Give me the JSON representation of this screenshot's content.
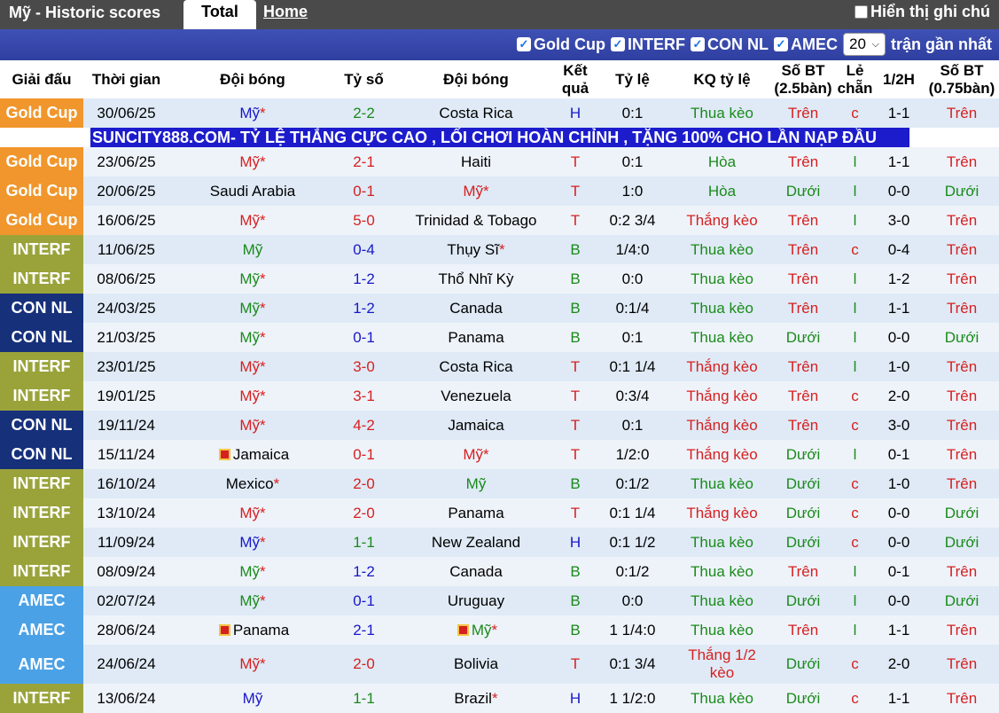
{
  "topbar": {
    "title": "Mỹ - Historic scores",
    "tab_total": "Total",
    "tab_home": "Home",
    "note_label": "Hiển thị ghi chú"
  },
  "filters": {
    "items": [
      "Gold Cup",
      "INTERF",
      "CON NL",
      "AMEC"
    ],
    "count_value": "20",
    "count_suffix": "trận gần nhất"
  },
  "columns": {
    "league": "Giải đấu",
    "time": "Thời gian",
    "home": "Đội bóng",
    "score": "Tỷ số",
    "away": "Đội bóng",
    "result": "Kết quả",
    "odds": "Tỷ lệ",
    "odds_result": "KQ tỷ lệ",
    "ou25": "Số BT (2.5bàn)",
    "oddeven": "Lẻ chẵn",
    "half": "1/2H",
    "ou075": "Số BT (0.75bàn)"
  },
  "league_colors": {
    "Gold Cup": "#f0962c",
    "INTERF": "#9aa33a",
    "CON NL": "#16307a",
    "AMEC": "#4aa1e6"
  },
  "ad_text": "SUNCITY888.COM- TỶ LỆ THẮNG CỰC CAO , LỐI CHƠI HOÀN CHỈNH , TẶNG 100% CHO LẦN NẠP ĐẦU",
  "rows": [
    {
      "league": "Gold Cup",
      "time": "30/06/25",
      "home": "Mỹ",
      "home_star": "*",
      "home_flag": false,
      "home_color": "blue",
      "score": "2-2",
      "score_color": "green",
      "away": "Costa Rica",
      "away_star": "",
      "away_flag": false,
      "away_color": "black",
      "result": "H",
      "result_color": "blue",
      "odds": "0:1",
      "odds_result": "Thua kèo",
      "odds_result_color": "green",
      "ou25": "Trên",
      "ou25_color": "red",
      "oddeven": "c",
      "oddeven_color": "red",
      "half": "1-1",
      "ou075": "Trên",
      "ou075_color": "red"
    },
    {
      "league": "Gold Cup",
      "time": "23/06/25",
      "home": "Mỹ",
      "home_star": "*",
      "home_flag": false,
      "home_color": "red",
      "score": "2-1",
      "score_color": "red",
      "away": "Haiti",
      "away_star": "",
      "away_flag": false,
      "away_color": "black",
      "result": "T",
      "result_color": "red",
      "odds": "0:1",
      "odds_result": "Hòa",
      "odds_result_color": "green",
      "ou25": "Trên",
      "ou25_color": "red",
      "oddeven": "l",
      "oddeven_color": "green",
      "half": "1-1",
      "ou075": "Trên",
      "ou075_color": "red"
    },
    {
      "league": "Gold Cup",
      "time": "20/06/25",
      "home": "Saudi Arabia",
      "home_star": "",
      "home_flag": false,
      "home_color": "black",
      "score": "0-1",
      "score_color": "red",
      "away": "Mỹ",
      "away_star": "*",
      "away_flag": false,
      "away_color": "red",
      "result": "T",
      "result_color": "red",
      "odds": "1:0",
      "odds_result": "Hòa",
      "odds_result_color": "green",
      "ou25": "Dưới",
      "ou25_color": "green",
      "oddeven": "l",
      "oddeven_color": "green",
      "half": "0-0",
      "ou075": "Dưới",
      "ou075_color": "green"
    },
    {
      "league": "Gold Cup",
      "time": "16/06/25",
      "home": "Mỹ",
      "home_star": "*",
      "home_flag": false,
      "home_color": "red",
      "score": "5-0",
      "score_color": "red",
      "away": "Trinidad & Tobago",
      "away_star": "",
      "away_flag": false,
      "away_color": "black",
      "result": "T",
      "result_color": "red",
      "odds": "0:2 3/4",
      "odds_result": "Thắng kèo",
      "odds_result_color": "red",
      "ou25": "Trên",
      "ou25_color": "red",
      "oddeven": "l",
      "oddeven_color": "green",
      "half": "3-0",
      "ou075": "Trên",
      "ou075_color": "red"
    },
    {
      "league": "INTERF",
      "time": "11/06/25",
      "home": "Mỹ",
      "home_star": "",
      "home_flag": false,
      "home_color": "green",
      "score": "0-4",
      "score_color": "blue",
      "away": "Thụy Sĩ",
      "away_star": "*",
      "away_flag": false,
      "away_color": "black",
      "result": "B",
      "result_color": "green",
      "odds": "1/4:0",
      "odds_result": "Thua kèo",
      "odds_result_color": "green",
      "ou25": "Trên",
      "ou25_color": "red",
      "oddeven": "c",
      "oddeven_color": "red",
      "half": "0-4",
      "ou075": "Trên",
      "ou075_color": "red"
    },
    {
      "league": "INTERF",
      "time": "08/06/25",
      "home": "Mỹ",
      "home_star": "*",
      "home_flag": false,
      "home_color": "green",
      "score": "1-2",
      "score_color": "blue",
      "away": "Thổ Nhĩ Kỳ",
      "away_star": "",
      "away_flag": false,
      "away_color": "black",
      "result": "B",
      "result_color": "green",
      "odds": "0:0",
      "odds_result": "Thua kèo",
      "odds_result_color": "green",
      "ou25": "Trên",
      "ou25_color": "red",
      "oddeven": "l",
      "oddeven_color": "green",
      "half": "1-2",
      "ou075": "Trên",
      "ou075_color": "red"
    },
    {
      "league": "CON NL",
      "time": "24/03/25",
      "home": "Mỹ",
      "home_star": "*",
      "home_flag": false,
      "home_color": "green",
      "score": "1-2",
      "score_color": "blue",
      "away": "Canada",
      "away_star": "",
      "away_flag": false,
      "away_color": "black",
      "result": "B",
      "result_color": "green",
      "odds": "0:1/4",
      "odds_result": "Thua kèo",
      "odds_result_color": "green",
      "ou25": "Trên",
      "ou25_color": "red",
      "oddeven": "l",
      "oddeven_color": "green",
      "half": "1-1",
      "ou075": "Trên",
      "ou075_color": "red"
    },
    {
      "league": "CON NL",
      "time": "21/03/25",
      "home": "Mỹ",
      "home_star": "*",
      "home_flag": false,
      "home_color": "green",
      "score": "0-1",
      "score_color": "blue",
      "away": "Panama",
      "away_star": "",
      "away_flag": false,
      "away_color": "black",
      "result": "B",
      "result_color": "green",
      "odds": "0:1",
      "odds_result": "Thua kèo",
      "odds_result_color": "green",
      "ou25": "Dưới",
      "ou25_color": "green",
      "oddeven": "l",
      "oddeven_color": "green",
      "half": "0-0",
      "ou075": "Dưới",
      "ou075_color": "green"
    },
    {
      "league": "INTERF",
      "time": "23/01/25",
      "home": "Mỹ",
      "home_star": "*",
      "home_flag": false,
      "home_color": "red",
      "score": "3-0",
      "score_color": "red",
      "away": "Costa Rica",
      "away_star": "",
      "away_flag": false,
      "away_color": "black",
      "result": "T",
      "result_color": "red",
      "odds": "0:1 1/4",
      "odds_result": "Thắng kèo",
      "odds_result_color": "red",
      "ou25": "Trên",
      "ou25_color": "red",
      "oddeven": "l",
      "oddeven_color": "green",
      "half": "1-0",
      "ou075": "Trên",
      "ou075_color": "red"
    },
    {
      "league": "INTERF",
      "time": "19/01/25",
      "home": "Mỹ",
      "home_star": "*",
      "home_flag": false,
      "home_color": "red",
      "score": "3-1",
      "score_color": "red",
      "away": "Venezuela",
      "away_star": "",
      "away_flag": false,
      "away_color": "black",
      "result": "T",
      "result_color": "red",
      "odds": "0:3/4",
      "odds_result": "Thắng kèo",
      "odds_result_color": "red",
      "ou25": "Trên",
      "ou25_color": "red",
      "oddeven": "c",
      "oddeven_color": "red",
      "half": "2-0",
      "ou075": "Trên",
      "ou075_color": "red"
    },
    {
      "league": "CON NL",
      "time": "19/11/24",
      "home": "Mỹ",
      "home_star": "*",
      "home_flag": false,
      "home_color": "red",
      "score": "4-2",
      "score_color": "red",
      "away": "Jamaica",
      "away_star": "",
      "away_flag": false,
      "away_color": "black",
      "result": "T",
      "result_color": "red",
      "odds": "0:1",
      "odds_result": "Thắng kèo",
      "odds_result_color": "red",
      "ou25": "Trên",
      "ou25_color": "red",
      "oddeven": "c",
      "oddeven_color": "red",
      "half": "3-0",
      "ou075": "Trên",
      "ou075_color": "red"
    },
    {
      "league": "CON NL",
      "time": "15/11/24",
      "home": "Jamaica",
      "home_star": "",
      "home_flag": true,
      "home_color": "black",
      "score": "0-1",
      "score_color": "red",
      "away": "Mỹ",
      "away_star": "*",
      "away_flag": false,
      "away_color": "red",
      "result": "T",
      "result_color": "red",
      "odds": "1/2:0",
      "odds_result": "Thắng kèo",
      "odds_result_color": "red",
      "ou25": "Dưới",
      "ou25_color": "green",
      "oddeven": "l",
      "oddeven_color": "green",
      "half": "0-1",
      "ou075": "Trên",
      "ou075_color": "red"
    },
    {
      "league": "INTERF",
      "time": "16/10/24",
      "home": "Mexico",
      "home_star": "*",
      "home_flag": false,
      "home_color": "black",
      "score": "2-0",
      "score_color": "red",
      "away": "Mỹ",
      "away_star": "",
      "away_flag": false,
      "away_color": "green",
      "result": "B",
      "result_color": "green",
      "odds": "0:1/2",
      "odds_result": "Thua kèo",
      "odds_result_color": "green",
      "ou25": "Dưới",
      "ou25_color": "green",
      "oddeven": "c",
      "oddeven_color": "red",
      "half": "1-0",
      "ou075": "Trên",
      "ou075_color": "red"
    },
    {
      "league": "INTERF",
      "time": "13/10/24",
      "home": "Mỹ",
      "home_star": "*",
      "home_flag": false,
      "home_color": "red",
      "score": "2-0",
      "score_color": "red",
      "away": "Panama",
      "away_star": "",
      "away_flag": false,
      "away_color": "black",
      "result": "T",
      "result_color": "red",
      "odds": "0:1 1/4",
      "odds_result": "Thắng kèo",
      "odds_result_color": "red",
      "ou25": "Dưới",
      "ou25_color": "green",
      "oddeven": "c",
      "oddeven_color": "red",
      "half": "0-0",
      "ou075": "Dưới",
      "ou075_color": "green"
    },
    {
      "league": "INTERF",
      "time": "11/09/24",
      "home": "Mỹ",
      "home_star": "*",
      "home_flag": false,
      "home_color": "blue",
      "score": "1-1",
      "score_color": "green",
      "away": "New Zealand",
      "away_star": "",
      "away_flag": false,
      "away_color": "black",
      "result": "H",
      "result_color": "blue",
      "odds": "0:1 1/2",
      "odds_result": "Thua kèo",
      "odds_result_color": "green",
      "ou25": "Dưới",
      "ou25_color": "green",
      "oddeven": "c",
      "oddeven_color": "red",
      "half": "0-0",
      "ou075": "Dưới",
      "ou075_color": "green"
    },
    {
      "league": "INTERF",
      "time": "08/09/24",
      "home": "Mỹ",
      "home_star": "*",
      "home_flag": false,
      "home_color": "green",
      "score": "1-2",
      "score_color": "blue",
      "away": "Canada",
      "away_star": "",
      "away_flag": false,
      "away_color": "black",
      "result": "B",
      "result_color": "green",
      "odds": "0:1/2",
      "odds_result": "Thua kèo",
      "odds_result_color": "green",
      "ou25": "Trên",
      "ou25_color": "red",
      "oddeven": "l",
      "oddeven_color": "green",
      "half": "0-1",
      "ou075": "Trên",
      "ou075_color": "red"
    },
    {
      "league": "AMEC",
      "time": "02/07/24",
      "home": "Mỹ",
      "home_star": "*",
      "home_flag": false,
      "home_color": "green",
      "score": "0-1",
      "score_color": "blue",
      "away": "Uruguay",
      "away_star": "",
      "away_flag": false,
      "away_color": "black",
      "result": "B",
      "result_color": "green",
      "odds": "0:0",
      "odds_result": "Thua kèo",
      "odds_result_color": "green",
      "ou25": "Dưới",
      "ou25_color": "green",
      "oddeven": "l",
      "oddeven_color": "green",
      "half": "0-0",
      "ou075": "Dưới",
      "ou075_color": "green"
    },
    {
      "league": "AMEC",
      "time": "28/06/24",
      "home": "Panama",
      "home_star": "",
      "home_flag": true,
      "home_color": "black",
      "score": "2-1",
      "score_color": "blue",
      "away": "Mỹ",
      "away_star": "*",
      "away_flag": true,
      "away_color": "green",
      "result": "B",
      "result_color": "green",
      "odds": "1 1/4:0",
      "odds_result": "Thua kèo",
      "odds_result_color": "green",
      "ou25": "Trên",
      "ou25_color": "red",
      "oddeven": "l",
      "oddeven_color": "green",
      "half": "1-1",
      "ou075": "Trên",
      "ou075_color": "red"
    },
    {
      "league": "AMEC",
      "time": "24/06/24",
      "home": "Mỹ",
      "home_star": "*",
      "home_flag": false,
      "home_color": "red",
      "score": "2-0",
      "score_color": "red",
      "away": "Bolivia",
      "away_star": "",
      "away_flag": false,
      "away_color": "black",
      "result": "T",
      "result_color": "red",
      "odds": "0:1 3/4",
      "odds_result": "Thắng 1/2 kèo",
      "odds_result_color": "red",
      "ou25": "Dưới",
      "ou25_color": "green",
      "oddeven": "c",
      "oddeven_color": "red",
      "half": "2-0",
      "ou075": "Trên",
      "ou075_color": "red"
    },
    {
      "league": "INTERF",
      "time": "13/06/24",
      "home": "Mỹ",
      "home_star": "",
      "home_flag": false,
      "home_color": "blue",
      "score": "1-1",
      "score_color": "green",
      "away": "Brazil",
      "away_star": "*",
      "away_flag": false,
      "away_color": "black",
      "result": "H",
      "result_color": "blue",
      "odds": "1 1/2:0",
      "odds_result": "Thua kèo",
      "odds_result_color": "green",
      "ou25": "Dưới",
      "ou25_color": "green",
      "oddeven": "c",
      "oddeven_color": "red",
      "half": "1-1",
      "ou075": "Trên",
      "ou075_color": "red"
    }
  ]
}
